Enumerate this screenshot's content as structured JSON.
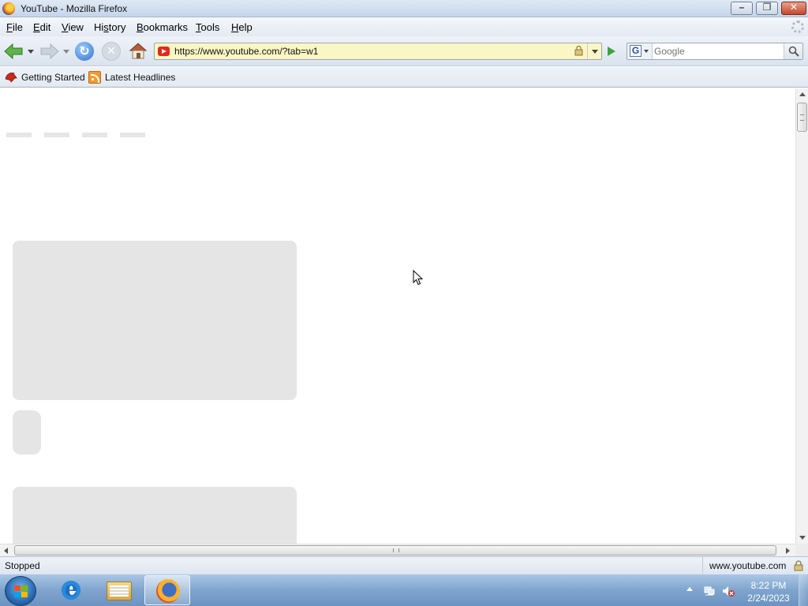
{
  "window": {
    "title": "YouTube - Mozilla Firefox",
    "buttons": {
      "minimize_icon": "minimize-icon",
      "maximize_icon": "restore-icon",
      "close_icon": "close-icon"
    }
  },
  "menubar": {
    "items": [
      {
        "accel": "F",
        "rest": "ile"
      },
      {
        "accel": "E",
        "rest": "dit"
      },
      {
        "accel": "V",
        "rest": "iew"
      },
      {
        "accel": "",
        "pre": "Hi",
        "accel2": "s",
        "rest": "tory"
      },
      {
        "accel": "B",
        "rest": "ookmarks"
      },
      {
        "accel": "T",
        "rest": "ools"
      },
      {
        "accel": "H",
        "rest": "elp"
      }
    ],
    "labels": [
      "File",
      "Edit",
      "View",
      "History",
      "Bookmarks",
      "Tools",
      "Help"
    ]
  },
  "navbar": {
    "url": "https://www.youtube.com/?tab=w1",
    "search_placeholder": "Google",
    "search_engine_letter": "G"
  },
  "bookmarks": {
    "items": [
      {
        "label": "Getting Started",
        "icon": "firefox-bookmark-icon"
      },
      {
        "label": "Latest Headlines",
        "icon": "rss-feed-icon"
      }
    ]
  },
  "status": {
    "text": "Stopped",
    "host": "www.youtube.com"
  },
  "taskbar": {
    "pinned": [
      "internet-explorer-icon",
      "windows-explorer-icon",
      "firefox-icon"
    ],
    "clock_time": "8:22 PM",
    "clock_date": "2/24/2023"
  },
  "colors": {
    "url_bar_bg": "#fbf7c4",
    "skeleton": "#e5e5e5",
    "youtube_red": "#e02b1c"
  }
}
